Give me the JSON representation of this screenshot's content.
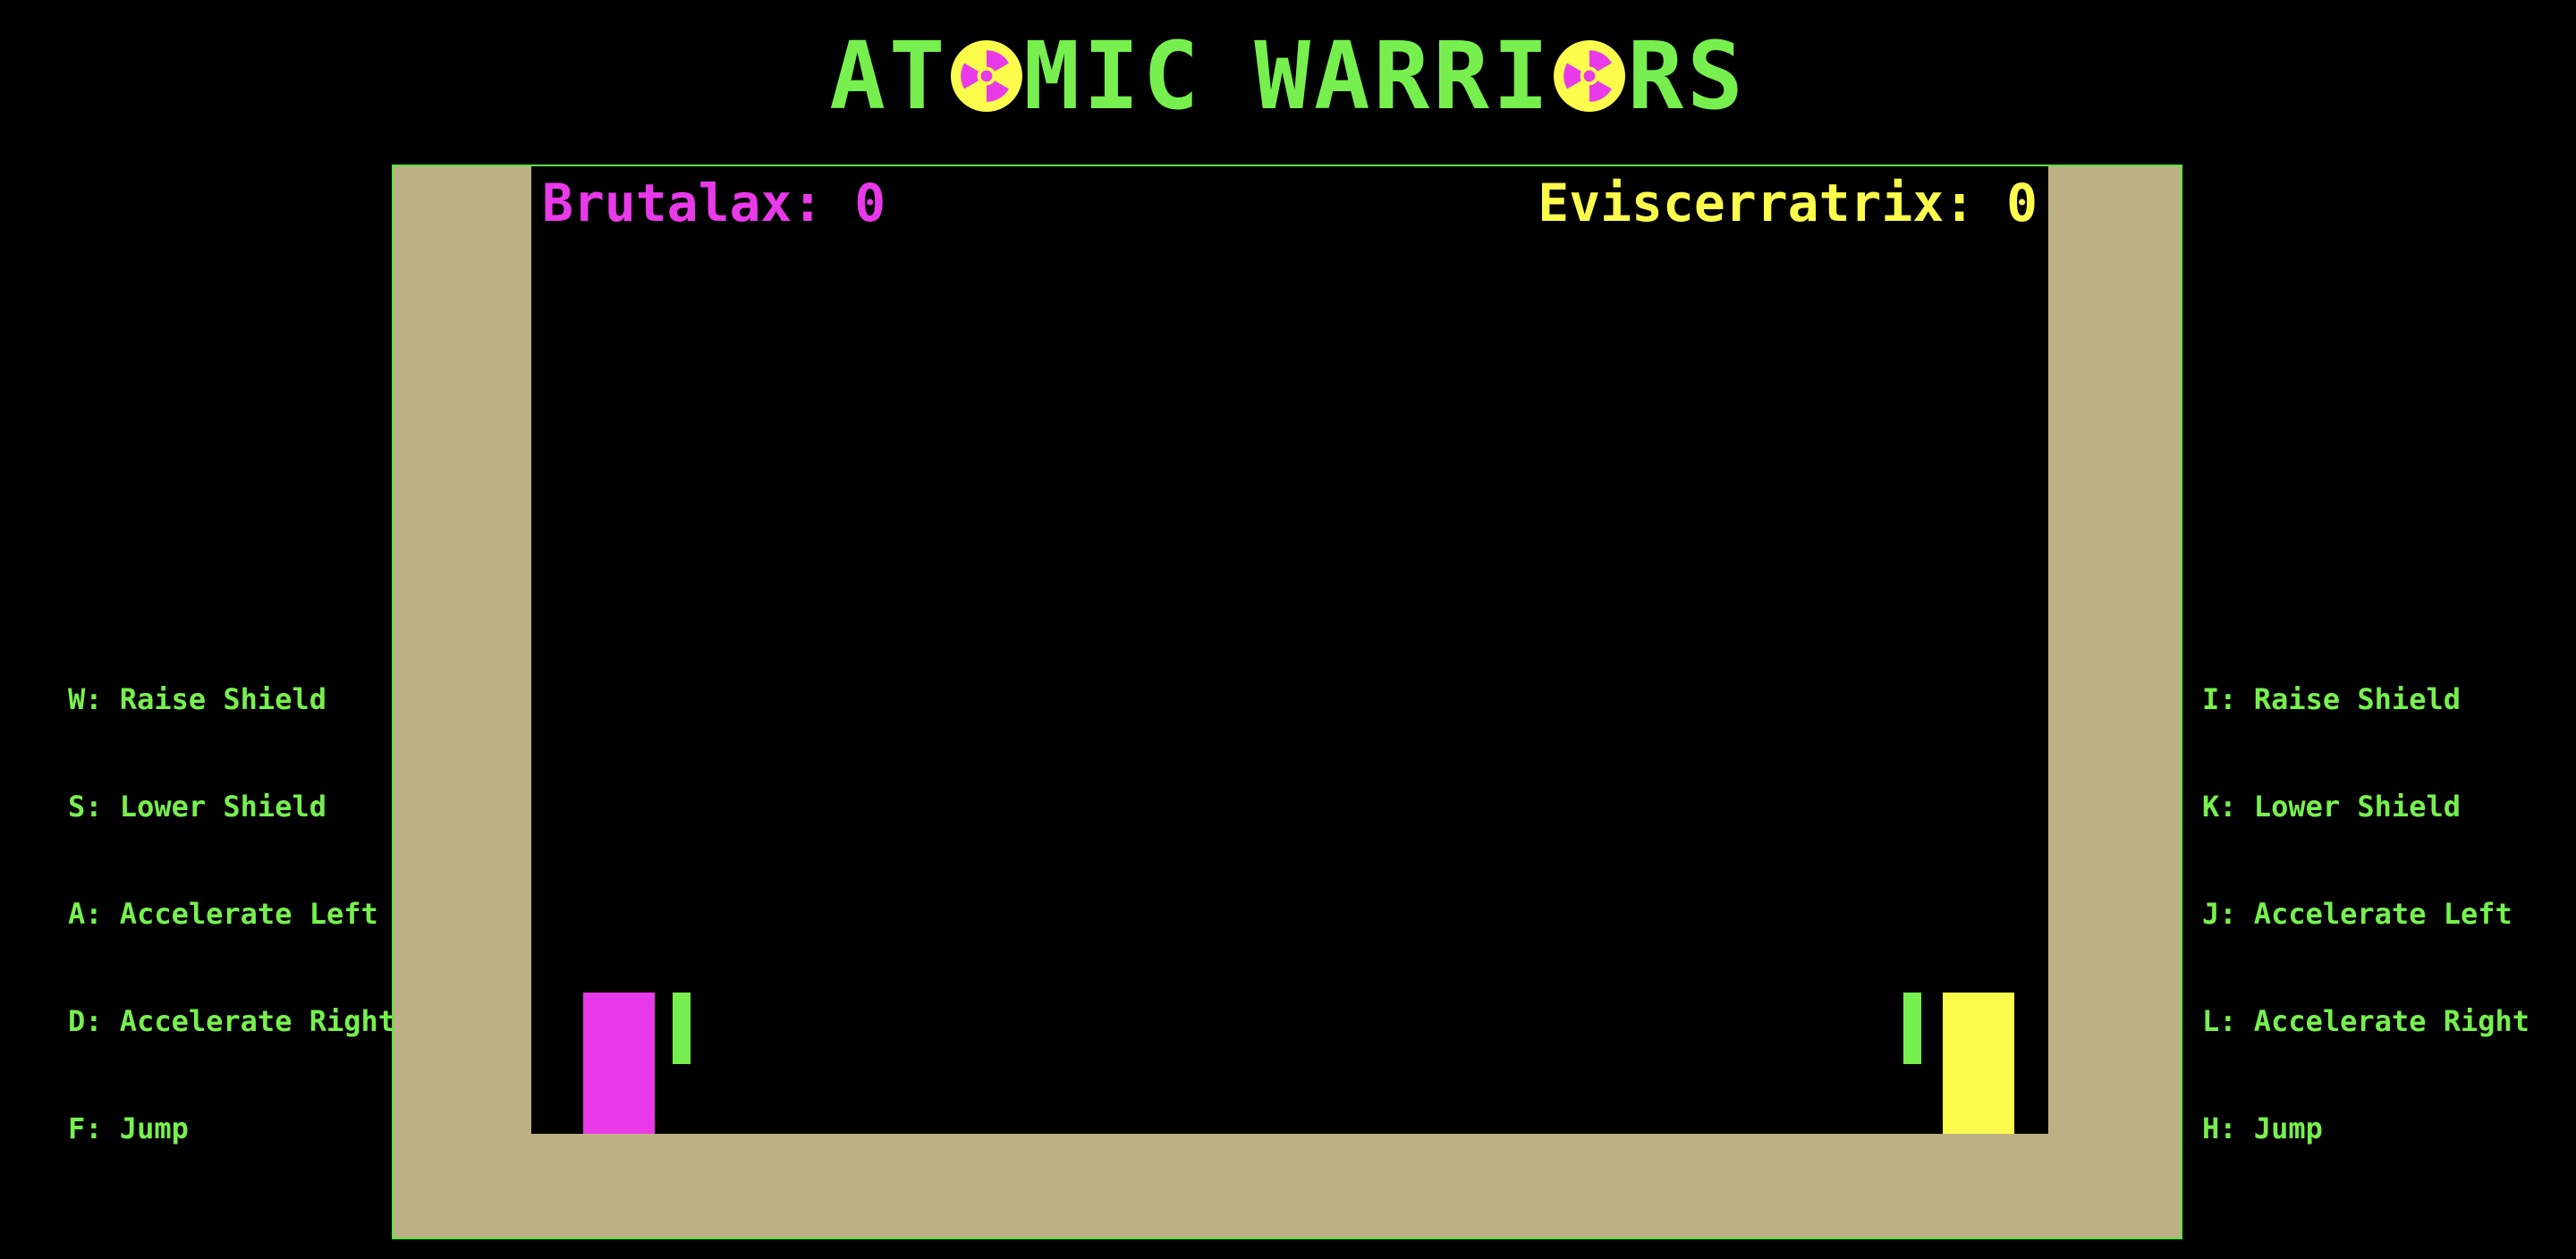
{
  "title": {
    "part1": "AT",
    "part2": "MIC",
    "part3": "WARRI",
    "part4": "RS",
    "icon": "radiation-trefoil-icon"
  },
  "colors": {
    "background": "#000000",
    "accent_green": "#77f04f",
    "wall": "#beb085",
    "player1": "#e83ae8",
    "player2": "#fcfc4c"
  },
  "players": [
    {
      "name_label": "Brutalax: 0",
      "color": "#e83ae8"
    },
    {
      "name_label": "Eviscerratrix: 0",
      "color": "#fcfc4c"
    }
  ],
  "controls": {
    "left": [
      "W: Raise Shield",
      "S: Lower Shield",
      "A: Accelerate Left",
      "D: Accelerate Right",
      "F: Jump"
    ],
    "right": [
      "I: Raise Shield",
      "K: Lower Shield",
      "J: Accelerate Left",
      "L: Accelerate Right",
      "H: Jump"
    ]
  }
}
